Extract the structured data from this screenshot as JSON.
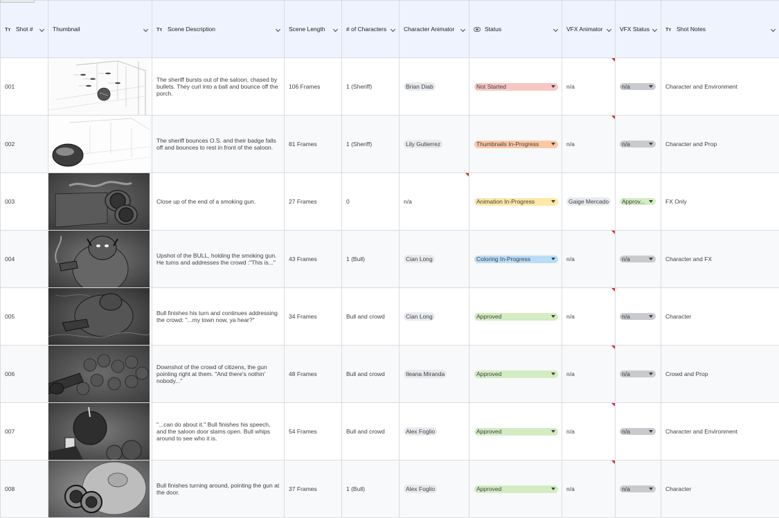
{
  "columns": [
    {
      "label": "Shot #",
      "type_icon": "text-type-icon"
    },
    {
      "label": "Thumbnail",
      "type_icon": ""
    },
    {
      "label": "Scene Description",
      "type_icon": "text-type-icon"
    },
    {
      "label": "Scene Length",
      "type_icon": ""
    },
    {
      "label": "# of Characters",
      "type_icon": ""
    },
    {
      "label": "Character Animator",
      "type_icon": ""
    },
    {
      "label": "Status",
      "type_icon": "dropdown-type-icon"
    },
    {
      "label": "VFX Animator",
      "type_icon": ""
    },
    {
      "label": "VFX Status",
      "type_icon": ""
    },
    {
      "label": "Shot Notes",
      "type_icon": "text-type-icon"
    }
  ],
  "status_colors": {
    "Not Started": "#f8c7c3",
    "Thumbnails In-Progress": "#fbc8a6",
    "Animation In-Progress": "#fde8a6",
    "Coloring In-Progress": "#b9ddf6",
    "Approved": "#d3ecc3",
    "Approv...": "#d3ecc3",
    "n/a": "#c8cacd"
  },
  "rows": [
    {
      "shot": "001",
      "thumb_icon": "storyboard-saloon-sketch-icon",
      "description": "The sheriff bursts out of the saloon, chased by bullets. They curl into a ball and bounce off the porch.",
      "length": "106 Frames",
      "characters": "1 (Sheriff)",
      "char_animator": "Brian Diab",
      "status": "Not Started",
      "vfx_animator": "n/a",
      "vfx_status": "n/a",
      "notes": "Character and Environment"
    },
    {
      "shot": "002",
      "thumb_icon": "storyboard-badge-sketch-icon",
      "description": "The sheriff bounces O.S. and their badge falls off and bounces to rest in front of the saloon.",
      "length": "81 Frames",
      "characters": "1 (Sheriff)",
      "char_animator": "Lily Gutierrez",
      "status": "Thumbnails In-Progress",
      "vfx_animator": "n/a",
      "vfx_status": "n/a",
      "notes": "Character and Prop"
    },
    {
      "shot": "003",
      "thumb_icon": "storyboard-smoking-gun-icon",
      "description": "Close up of the end of a smoking gun.",
      "length": "27 Frames",
      "characters": "0",
      "char_animator": "n/a",
      "status": "Animation In-Progress",
      "vfx_animator": "Gaige Mercado",
      "vfx_status": "Approv...",
      "notes": "FX Only"
    },
    {
      "shot": "004",
      "thumb_icon": "storyboard-bull-gun-icon",
      "description": "Upshot of the BULL, holding the smoking gun. He turns and addresses the crowd :\"This is...\"",
      "length": "43 Frames",
      "characters": "1 (Bull)",
      "char_animator": "Cian Long",
      "status": "Coloring In-Progress",
      "vfx_animator": "n/a",
      "vfx_status": "n/a",
      "notes": "Character and FX"
    },
    {
      "shot": "005",
      "thumb_icon": "storyboard-bull-turn-icon",
      "description": "Bull finishes his turn and continues addressing the crowd: \"...my town now, ya hear?\"",
      "length": "34 Frames",
      "characters": "Bull and crowd",
      "char_animator": "Cian Long",
      "status": "Approved",
      "vfx_animator": "n/a",
      "vfx_status": "n/a",
      "notes": "Character"
    },
    {
      "shot": "006",
      "thumb_icon": "storyboard-crowd-icon",
      "description": "Downshot of the crowd of citizens, the gun pointing right at them. \"And there's nothin' nobody...\"",
      "length": "48 Frames",
      "characters": "Bull and crowd",
      "char_animator": "Ileana Miranda",
      "status": "Approved",
      "vfx_animator": "n/a",
      "vfx_status": "n/a",
      "notes": "Crowd and Prop"
    },
    {
      "shot": "007",
      "thumb_icon": "storyboard-saloon-door-icon",
      "description": "\"...can do about it.\" Bull finishes his speech, and the saloon door slams open. Bull whips around to see who it is.",
      "length": "54 Frames",
      "characters": "Bull and crowd",
      "char_animator": "Alex Foglio",
      "status": "Approved",
      "vfx_animator": "n/a",
      "vfx_status": "n/a",
      "notes": "Character and Environment"
    },
    {
      "shot": "008",
      "thumb_icon": "storyboard-bull-pointing-icon",
      "description": "Bull finishes turning around, pointing the gun at the door.",
      "length": "37 Frames",
      "characters": "1 (Bull)",
      "char_animator": "Alex Foglio",
      "status": "Approved",
      "vfx_animator": "n/a",
      "vfx_status": "n/a",
      "notes": "Character"
    }
  ]
}
